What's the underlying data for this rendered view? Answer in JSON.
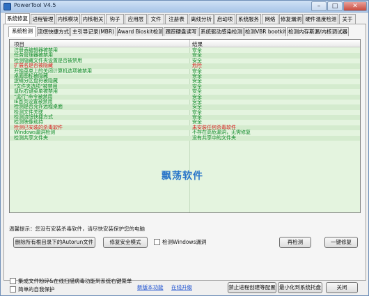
{
  "window": {
    "title": "PowerTool V4.5",
    "minimize": "–",
    "maximize": "□",
    "close": "✕"
  },
  "main_tabs": [
    {
      "label": "系统修复",
      "active": true
    },
    {
      "label": "进程管理"
    },
    {
      "label": "内核模块"
    },
    {
      "label": "内核相关"
    },
    {
      "label": "钩子"
    },
    {
      "label": "应用层"
    },
    {
      "label": "文件"
    },
    {
      "label": "注册表"
    },
    {
      "label": "离线分析"
    },
    {
      "label": "启动项"
    },
    {
      "label": "系统服务"
    },
    {
      "label": "网络"
    },
    {
      "label": "修复漏洞"
    },
    {
      "label": "硬件温度检测"
    },
    {
      "label": "关于"
    }
  ],
  "sub_tabs": [
    {
      "label": "系统检测",
      "active": true
    },
    {
      "label": "流氓快捷方式"
    },
    {
      "label": "主引导记录(MBR)"
    },
    {
      "label": "Award Bioskit检测"
    },
    {
      "label": "跟踪硬盘读写"
    },
    {
      "label": "系统驱动感染检测"
    },
    {
      "label": "检测VBR bootkit"
    },
    {
      "label": "检测内存斯漏/内核调试器"
    }
  ],
  "list": {
    "col_item": "项目",
    "col_result": "结果",
    "rows": [
      {
        "item": "注册表编辑器被禁用",
        "result": "安全",
        "status": "safe"
      },
      {
        "item": "任务管理器被禁用",
        "result": "安全",
        "status": "safe"
      },
      {
        "item": "检测隐藏文件夹设置是否被禁用",
        "result": "安全",
        "status": "safe"
      },
      {
        "item": "扩展名是否被隐藏",
        "result": "危险",
        "status": "danger"
      },
      {
        "item": "开始菜单上的关闭计算机选项被禁用",
        "result": "安全",
        "status": "safe"
      },
      {
        "item": "桌面图标被隐藏",
        "result": "安全",
        "status": "safe"
      },
      {
        "item": "逻辑分区盘符被隐藏",
        "result": "安全",
        "status": "safe"
      },
      {
        "item": "\"文件夹选项\"被禁用",
        "result": "安全",
        "status": "safe"
      },
      {
        "item": "鼠标右键菜单被禁用",
        "result": "安全",
        "status": "safe"
      },
      {
        "item": "\"运行\"命令被禁用",
        "result": "安全",
        "status": "safe"
      },
      {
        "item": "IE首页设置被禁用",
        "result": "安全",
        "status": "safe"
      },
      {
        "item": "检测是否允许远程桌面",
        "result": "安全",
        "status": "safe"
      },
      {
        "item": "检测文件关联",
        "result": "安全",
        "status": "safe"
      },
      {
        "item": "检测流氓快捷方式",
        "result": "安全",
        "status": "safe"
      },
      {
        "item": "检测映像劫持",
        "result": "安全",
        "status": "safe"
      },
      {
        "item": "检测已安装的杀毒软件",
        "result": "未安装任何杀毒软件",
        "status": "danger"
      },
      {
        "item": "Windows漏洞检测",
        "result": "不存在高危漏洞，无需修复",
        "status": "safe"
      },
      {
        "item": "检测共享文件夹",
        "result": "没有共享中的文件夹",
        "status": "safe"
      }
    ]
  },
  "watermark": "飘荡软件",
  "hint": "温馨提示：您没有安装杀毒软件，请尽快安装保护您的电脑",
  "buttons": {
    "delete_autorun": "删除所有根目录下的Autorun文件",
    "repair_safe_mode": "修复安全模式",
    "check_windows_vuln": "检测Windows漏洞",
    "recheck": "再检测",
    "one_click_repair": "一键修复"
  },
  "footer": {
    "integrate_menu": "集成文件粉碎&在线扫描病毒功能到系统右键菜单",
    "self_protect": "简单的自我保护",
    "new_features": "新版本功能",
    "online_update": "在线升级",
    "block_create_process": "禁止进程创建等配置",
    "minimize_tray": "最小化到系统托盘",
    "close": "关闭"
  }
}
